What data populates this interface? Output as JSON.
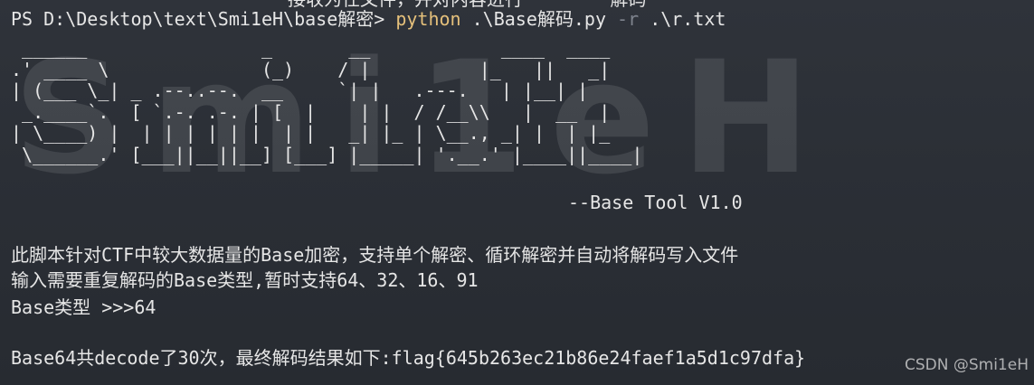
{
  "terminal": {
    "top_fragment": "接收为任文件，并对内容进行        解码",
    "prompt": "PS D:\\Desktop\\text\\Smi1eH\\base解密>",
    "command": {
      "program": "python",
      "script": ".\\Base解码.py",
      "flag": "-r",
      "argument": ".\\r.txt"
    },
    "banner_art": " ______                _       __            ____  ____\n.' ____ \\              (_)    / |          |_   ||   _|\n| (___ \\_| _ .--..--.  __     `| |   .---.   | |__| |\n _.____`.  [ `.-. .-. | [  |    | |  / /__\\\\   |  __  |\n| \\____) |  | | | | | |  | |   _| |_ | \\__., _| |  | |_\n \\______.' [___||__||__] [___] |_____| '.__.' |____||____|",
    "banner_letters": "Smi1eH",
    "subtitle": "--Base Tool V1.0",
    "description_1": "此脚本针对CTF中较大数据量的Base加密，支持单个解密、循环解密并自动将解码写入文件",
    "description_2": "输入需要重复解码的Base类型,暂时支持64、32、16、91",
    "type_prompt": "Base类型 >>>64",
    "result": "Base64共decode了30次，最终解码结果如下:flag{645b263ec21b86e24faef1a5d1c97dfa}"
  },
  "watermark": "CSDN @Smi1eH",
  "colors": {
    "background": "#2b2f36",
    "text": "#e6e6e6",
    "python_keyword": "#e5c07b",
    "flag_argument": "#7f848e"
  }
}
